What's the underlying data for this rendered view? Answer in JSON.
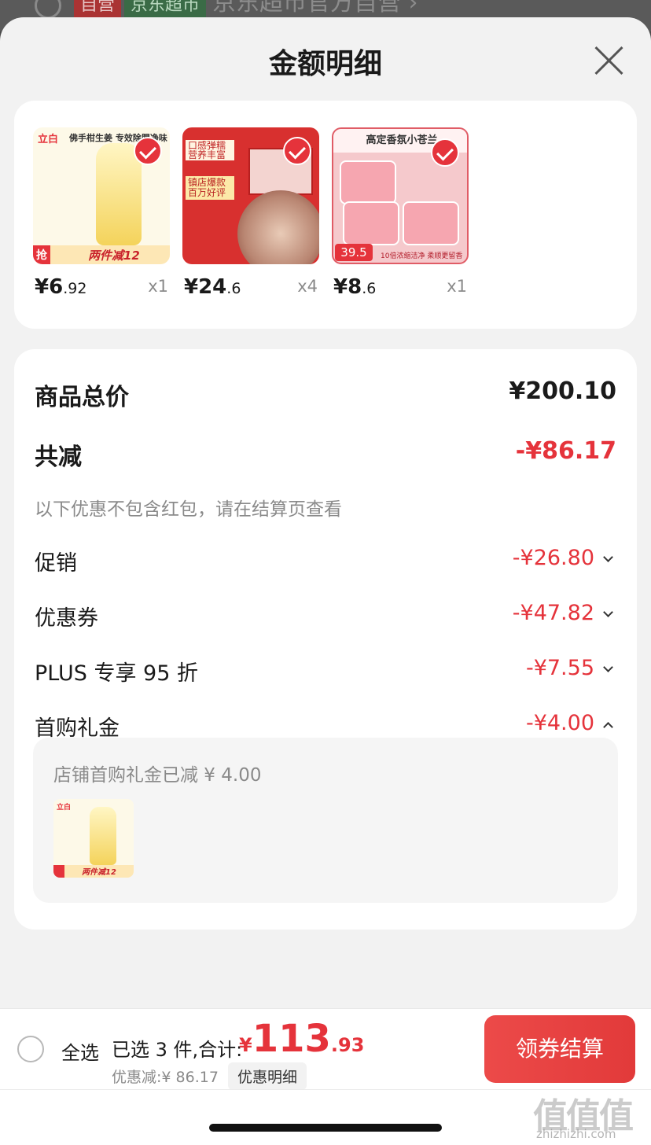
{
  "background": {
    "tag_self": "自营",
    "tag_market": "京东超市",
    "shop_name": "京东超市官方自营 ›"
  },
  "sheet": {
    "title": "金额明细"
  },
  "products": [
    {
      "logo": "立白",
      "headline": "佛手柑生姜 专效除腥净味",
      "banner_tag": "抢",
      "banner_text": "两件减12",
      "price_int": "¥6",
      "price_dec": ".92",
      "qty": "x1"
    },
    {
      "box1": "口感弹糯 营养丰富",
      "box2": "镇店爆款 百万好评",
      "price_int": "¥24",
      "price_dec": ".6",
      "qty": "x4"
    },
    {
      "head": "高定香氛小苍兰",
      "price_tag": "39.5",
      "foot": "10倍浓缩洁净 柔顺更留香",
      "price_int": "¥8",
      "price_dec": ".6",
      "qty": "x1"
    }
  ],
  "summary": {
    "total_label": "商品总价",
    "total_value": "¥200.10",
    "reduce_label": "共减",
    "reduce_value": "-¥86.17",
    "note": "以下优惠不包含红包，请在结算页查看",
    "items": [
      {
        "label": "促销",
        "value": "-¥26.80"
      },
      {
        "label": "优惠券",
        "value": "-¥47.82"
      },
      {
        "label": "PLUS 专享 95 折",
        "value": "-¥7.55"
      },
      {
        "label": "首购礼金",
        "value": "-¥4.00"
      }
    ],
    "gift_text": "店铺首购礼金已减 ¥ 4.00",
    "gift_banner": "两件减12",
    "gift_logo": "立白"
  },
  "bottom_bar": {
    "select_all": "全选",
    "selected_text": "已选 3 件,合计:",
    "currency": "¥",
    "total_int": "113",
    "total_dec": ".93",
    "discount_text": "优惠减:¥ 86.17",
    "discount_detail": "优惠明细",
    "checkout": "领券结算"
  },
  "watermark": {
    "logo": "值值值",
    "url": "zhizhizhi.com"
  },
  "colors": {
    "accent": "#e5333b",
    "sheet_bg": "#f2f2f2",
    "muted": "#8a8a8a"
  }
}
